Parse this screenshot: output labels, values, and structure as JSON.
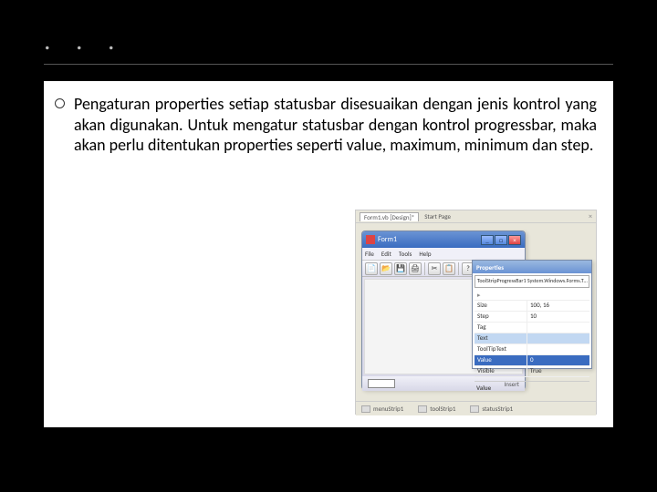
{
  "title": ". . .",
  "bullet_text": "Pengaturan properties setiap statusbar disesuaikan dengan jenis kontrol yang akan digunakan. Untuk mengatur statusbar dengan kontrol progressbar, maka akan perlu ditentukan properties seperti value, maximum, minimum dan step.",
  "screenshot": {
    "tabs": {
      "main": "Form1.vb [Design]*",
      "start": "Start Page",
      "close": "×"
    },
    "form": {
      "title": "Form1",
      "win_min": "_",
      "win_max": "□",
      "win_close": "×",
      "menu": [
        "File",
        "Edit",
        "Tools",
        "Help"
      ],
      "toolbar_icons": [
        "📄",
        "📂",
        "💾",
        "🖨",
        "✂",
        "📋",
        "?"
      ],
      "status_text": "Insert"
    },
    "props": {
      "title": "Properties",
      "combo": "ToolStripProgressBar1 System.Windows.Forms.T…",
      "category": "▸",
      "rows": [
        {
          "l": "Size",
          "r": "100, 16",
          "cls": ""
        },
        {
          "l": "Step",
          "r": "10",
          "cls": ""
        },
        {
          "l": "Tag",
          "r": "",
          "cls": ""
        },
        {
          "l": "Text",
          "r": "",
          "cls": "hl"
        },
        {
          "l": "ToolTipText",
          "r": "",
          "cls": ""
        },
        {
          "l": "Value",
          "r": "0",
          "cls": "hl2"
        },
        {
          "l": "Visible",
          "r": "True",
          "cls": ""
        }
      ],
      "desc_title": "Value"
    },
    "footer": [
      {
        "icon": "▭",
        "label": "menuStrip1"
      },
      {
        "icon": "▭",
        "label": "toolStrip1"
      },
      {
        "icon": "▭",
        "label": "statusStrip1"
      }
    ]
  }
}
